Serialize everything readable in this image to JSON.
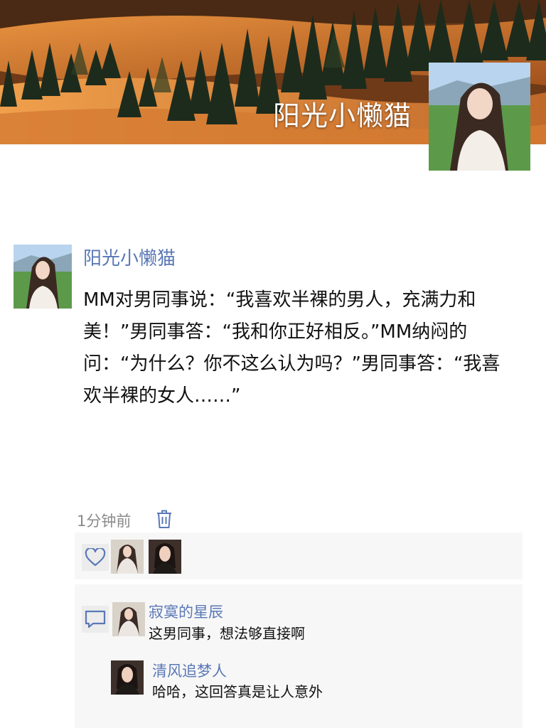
{
  "profile": {
    "cover_name": "阳光小懒猫"
  },
  "post": {
    "author": "阳光小懒猫",
    "content": "MM对男同事说：“我喜欢半裸的男人，充满力和美！”男同事答：“我和你正好相反。”MM纳闷的问：“为什么？你不这么认为吗？”男同事答：“我喜欢半裸的女人……”",
    "time": "1分钟前"
  },
  "likes": {
    "icon": "heart-outline-icon",
    "users": [
      "寂寞的星辰",
      "清风追梦人"
    ]
  },
  "comments": [
    {
      "author": "寂寞的星辰",
      "text": "这男同事，想法够直接啊"
    },
    {
      "author": "清风追梦人",
      "text": "哈哈，这回答真是让人意外"
    }
  ],
  "colors": {
    "link_blue": "#5a78b6",
    "panel_bg": "#f7f7f7",
    "time_gray": "#8a8a8a"
  }
}
